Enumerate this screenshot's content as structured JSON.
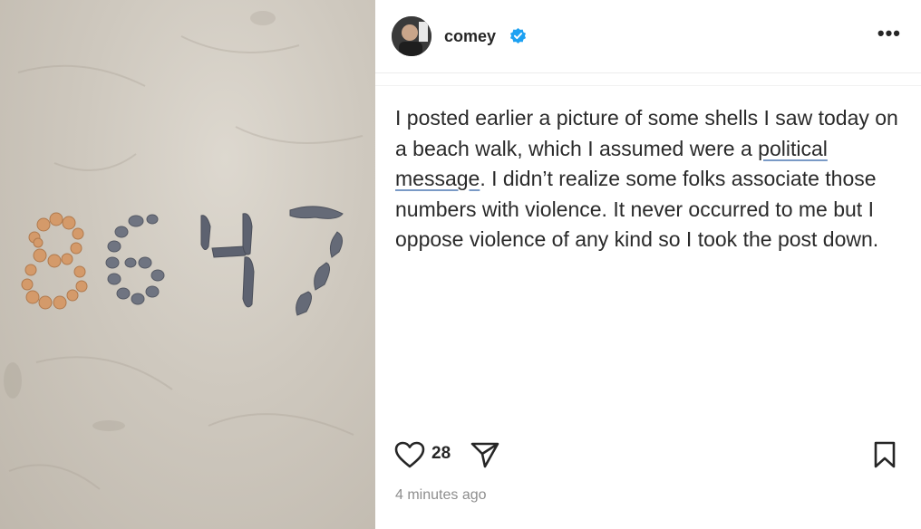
{
  "post": {
    "username": "comey",
    "verified": true,
    "more_label": "•••",
    "photo_numbers": "8647",
    "caption_before": "I posted earlier a picture of some shells I saw today on a beach walk, which I assumed were a ",
    "caption_link_1": "political",
    "caption_space": " ",
    "caption_link_2": "message",
    "caption_after": ". I didn’t realize some folks associate those numbers with violence. It never occurred to me but I oppose violence of any kind so I took the post down.",
    "likes": "28",
    "timestamp": "4 minutes ago"
  },
  "icons": {
    "like": "heart-icon",
    "share": "send-icon",
    "save": "bookmark-icon",
    "verified": "verified-badge-icon",
    "more": "more-options-icon"
  },
  "colors": {
    "verified_blue": "#1da1f2",
    "link_underline": "#7a9ac6",
    "timestamp_gray": "#8e8e8e"
  }
}
